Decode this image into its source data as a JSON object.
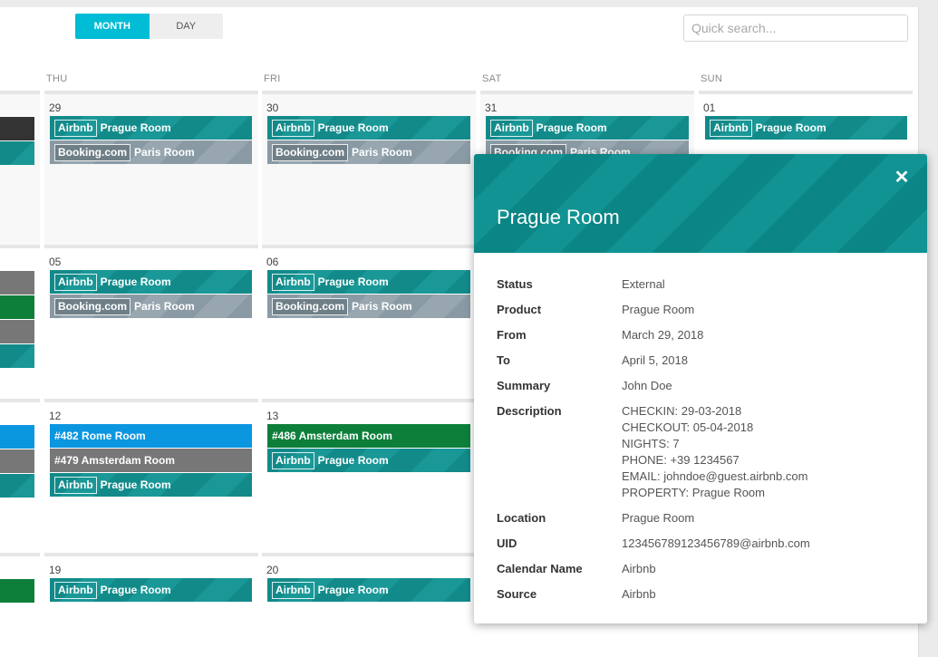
{
  "toolbar": {
    "month_label": "MONTH",
    "day_label": "DAY",
    "search_placeholder": "Quick search..."
  },
  "calendar": {
    "day_names": [
      "THU",
      "FRI",
      "SAT",
      "SUN"
    ],
    "rows": [
      {
        "days": [
          "29",
          "30",
          "31",
          "01"
        ],
        "events": {
          "thu": [
            {
              "tag": "Airbnb",
              "label": "Prague Room"
            },
            {
              "tag": "Booking.com",
              "label": "Paris Room"
            }
          ],
          "fri": [
            {
              "tag": "Airbnb",
              "label": "Prague Room"
            },
            {
              "tag": "Booking.com",
              "label": "Paris Room"
            }
          ],
          "sat": [
            {
              "tag": "Airbnb",
              "label": "Prague Room"
            },
            {
              "tag": "Booking.com",
              "label": "Paris Room"
            }
          ],
          "sun": [
            {
              "tag": "Airbnb",
              "label": "Prague Room"
            }
          ]
        }
      },
      {
        "days": [
          "05",
          "06"
        ],
        "events": {
          "thu": [
            {
              "tag": "Airbnb",
              "label": "Prague Room"
            },
            {
              "tag": "Booking.com",
              "label": "Paris Room"
            }
          ],
          "fri": [
            {
              "tag": "Airbnb",
              "label": "Prague Room"
            },
            {
              "tag": "Booking.com",
              "label": "Paris Room"
            }
          ]
        }
      },
      {
        "days": [
          "12",
          "13"
        ],
        "events": {
          "thu": [
            {
              "label": "#482 Rome Room"
            },
            {
              "label": "#479 Amsterdam Room"
            },
            {
              "tag": "Airbnb",
              "label": "Prague Room"
            }
          ],
          "fri": [
            {
              "label": "#486 Amsterdam Room"
            },
            {
              "tag": "Airbnb",
              "label": "Prague Room"
            }
          ]
        }
      },
      {
        "days": [
          "19",
          "20"
        ],
        "events": {
          "thu": [
            {
              "tag": "Airbnb",
              "label": "Prague Room"
            }
          ],
          "fri": [
            {
              "tag": "Airbnb",
              "label": "Prague Room"
            }
          ]
        }
      }
    ]
  },
  "popup": {
    "title": "Prague Room",
    "close_icon": "close-icon",
    "fields": [
      {
        "key": "Status",
        "value": "External"
      },
      {
        "key": "Product",
        "value": "Prague Room"
      },
      {
        "key": "From",
        "value": "March 29, 2018"
      },
      {
        "key": "To",
        "value": "April 5, 2018"
      },
      {
        "key": "Summary",
        "value": "John Doe"
      },
      {
        "key": "Description",
        "lines": [
          "CHECKIN: 29-03-2018",
          "CHECKOUT: 05-04-2018",
          "NIGHTS: 7",
          "PHONE: +39 1234567",
          "EMAIL: johndoe@guest.airbnb.com",
          "PROPERTY: Prague Room"
        ]
      },
      {
        "key": "Location",
        "value": "Prague Room"
      },
      {
        "key": "UID",
        "value": "123456789123456789@airbnb.com"
      },
      {
        "key": "Calendar Name",
        "value": "Airbnb"
      },
      {
        "key": "Source",
        "value": "Airbnb"
      }
    ]
  },
  "colors": {
    "accent": "#00bcd4",
    "airbnb": "#138a8a",
    "booking": "#8a9aa4",
    "rome": "#0b96e0",
    "amsterdam_grey": "#777777",
    "amsterdam_green": "#0d7f3b"
  }
}
